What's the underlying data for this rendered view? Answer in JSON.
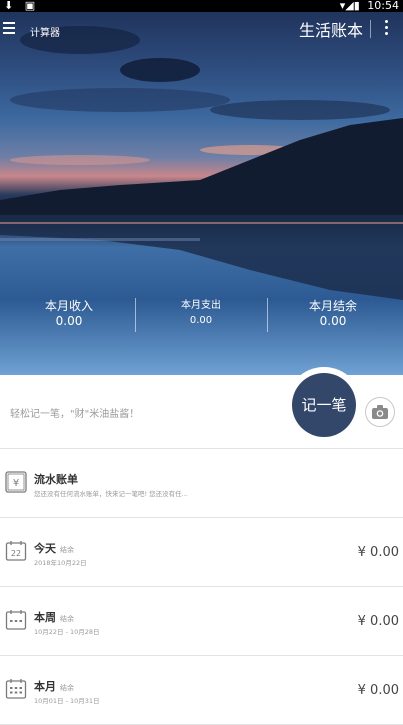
{
  "status_bar": {
    "left_icons": "⬇ ▣",
    "right_icons": "▾◢▮",
    "time": "10:54"
  },
  "toolbar": {
    "calculator_label": "计算器",
    "app_title": "生活账本"
  },
  "stats": [
    {
      "label": "本月收入",
      "value": "0.00"
    },
    {
      "label": "本月支出",
      "value": "0.00"
    },
    {
      "label": "本月结余",
      "value": "0.00"
    }
  ],
  "quick_entry": {
    "hint": "轻松记一笔，\"财\"米油盐酱！",
    "record_label": "记一笔"
  },
  "flow": {
    "title": "流水账单",
    "sub": "您还没有任何流水账单，快来记一笔吧! 您还没有任..."
  },
  "periods": [
    {
      "title": "今天",
      "tag": "结余",
      "date": "2018年10月22日",
      "amount": "¥ 0.00",
      "icon": "calendar-day-icon",
      "day": "22"
    },
    {
      "title": "本周",
      "tag": "结余",
      "date": "10月22日 - 10月28日",
      "amount": "¥ 0.00",
      "icon": "calendar-week-icon"
    },
    {
      "title": "本月",
      "tag": "结余",
      "date": "10月01日 - 10月31日",
      "amount": "¥ 0.00",
      "icon": "calendar-month-icon"
    }
  ],
  "colors": {
    "record_button": "#33476b",
    "divider": "#e3e3e3"
  }
}
